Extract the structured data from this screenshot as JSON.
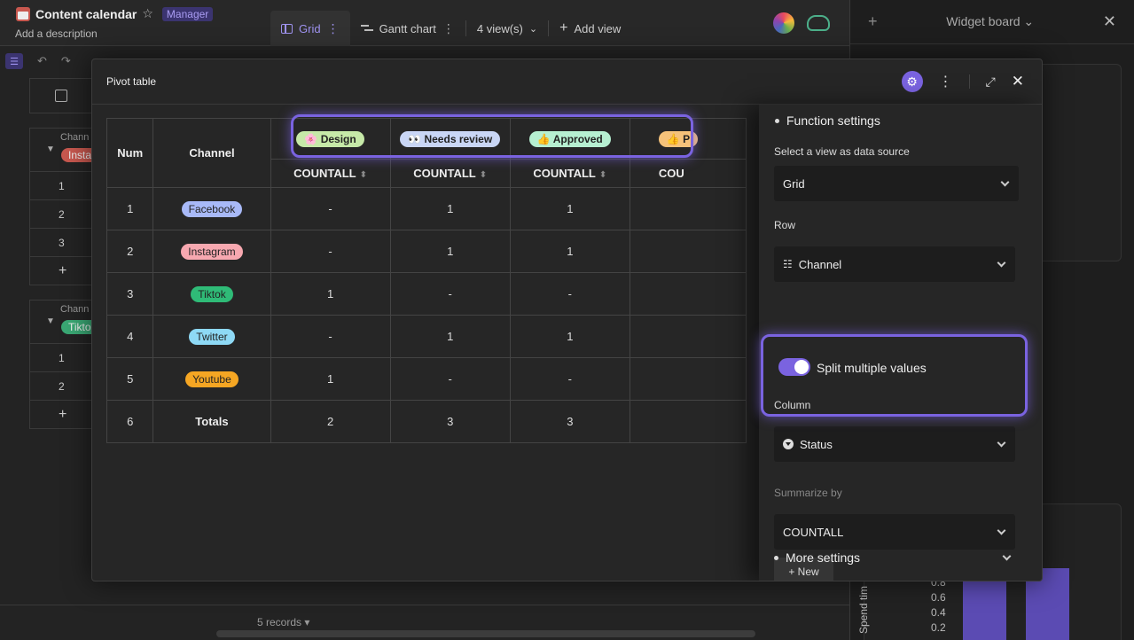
{
  "app": {
    "title": "Content calendar",
    "role_badge": "Manager",
    "description": "Add a description"
  },
  "view_tabs": [
    {
      "label": "Grid",
      "active": true
    },
    {
      "label": "Gantt chart",
      "active": false
    }
  ],
  "views_count": "4 view(s)",
  "add_view": "Add view",
  "widget_board": {
    "title": "Widget board",
    "chart": {
      "ylabel": "Spend tim",
      "ticks": [
        "0.8",
        "0.6",
        "0.4",
        "0.2"
      ]
    }
  },
  "background_grid": {
    "groups": [
      {
        "label": "Chann",
        "chip": "Insta",
        "chip_color": "#c8584f",
        "rows": [
          "1",
          "2",
          "3"
        ]
      },
      {
        "label": "Chann",
        "chip": "Tikto",
        "chip_color": "#3aa874",
        "rows": [
          "1",
          "2"
        ]
      }
    ],
    "records": "5 records ▾"
  },
  "modal": {
    "title": "Pivot table"
  },
  "pivot": {
    "headers": {
      "num": "Num",
      "channel": "Channel"
    },
    "status_columns": [
      {
        "label": "Design",
        "emoji": "🌸",
        "color": "#c6e9a8"
      },
      {
        "label": "Needs review",
        "emoji": "👀",
        "color": "#c9d6f5"
      },
      {
        "label": "Approved",
        "emoji": "👍",
        "color": "#b6efd1"
      },
      {
        "label": "P",
        "emoji": "👍",
        "color": "#f5c27a"
      }
    ],
    "measure": "COUNTALL",
    "measure_cut": "COU",
    "rows": [
      {
        "num": "1",
        "channel": "Facebook",
        "color": "#a8b9f7",
        "values": [
          "-",
          "1",
          "1"
        ]
      },
      {
        "num": "2",
        "channel": "Instagram",
        "color": "#f7a8b0",
        "values": [
          "-",
          "1",
          "1"
        ]
      },
      {
        "num": "3",
        "channel": "Tiktok",
        "color": "#2fbb77",
        "values": [
          "1",
          "-",
          "-"
        ]
      },
      {
        "num": "4",
        "channel": "Twitter",
        "color": "#8ed9f5",
        "values": [
          "-",
          "1",
          "1"
        ]
      },
      {
        "num": "5",
        "channel": "Youtube",
        "color": "#f5a623",
        "values": [
          "1",
          "-",
          "-"
        ]
      }
    ],
    "totals": {
      "num": "6",
      "label": "Totals",
      "values": [
        "2",
        "3",
        "3"
      ]
    }
  },
  "settings": {
    "section_title": "Function settings",
    "data_source_label": "Select a view as data source",
    "data_source_value": "Grid",
    "row_label": "Row",
    "row_value": "Channel",
    "split_label": "Split multiple values",
    "split_enabled": true,
    "column_label": "Column",
    "column_value": "Status",
    "summarize_label": "Summarize by",
    "summarize_value": "COUNTALL",
    "new_button": "+ New",
    "more_settings": "More settings"
  }
}
